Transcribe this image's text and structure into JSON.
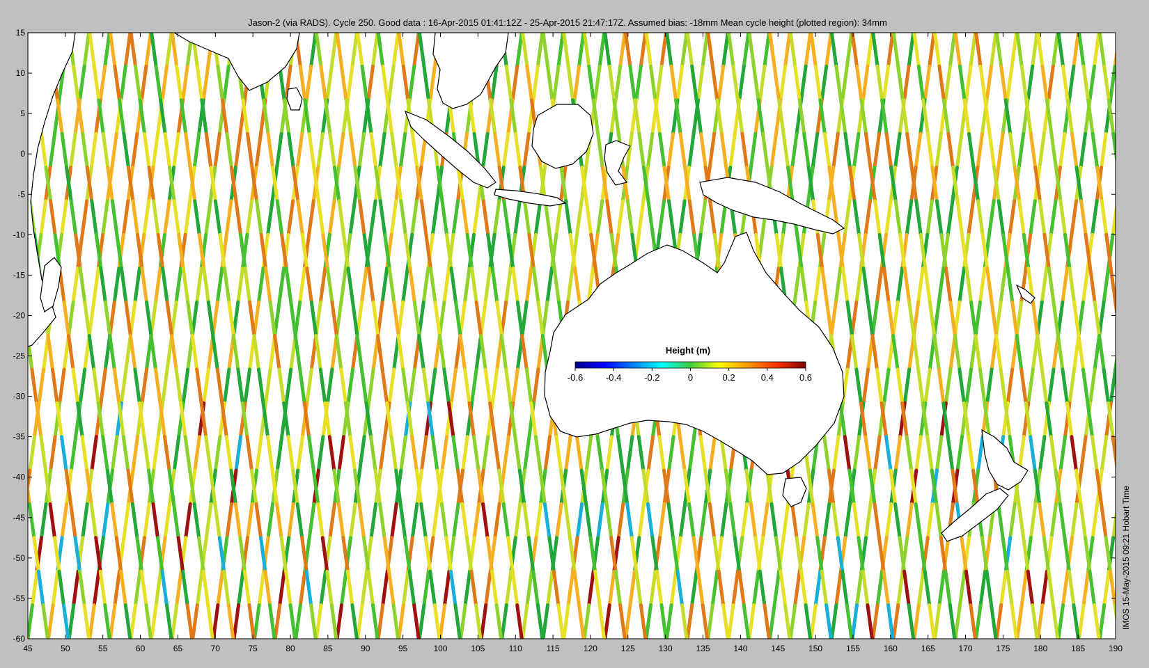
{
  "chart_data": {
    "type": "map",
    "title": "Jason-2 (via RADS). Cycle 250. Good data : 16-Apr-2015 01:41:12Z - 25-Apr-2015 21:47:17Z. Assumed bias: -18mm  Mean cycle height (plotted region): 34mm",
    "xlim": [
      45,
      190
    ],
    "ylim": [
      -60,
      15
    ],
    "x_ticks": [
      45,
      50,
      55,
      60,
      65,
      70,
      75,
      80,
      85,
      90,
      95,
      100,
      105,
      110,
      115,
      120,
      125,
      130,
      135,
      140,
      145,
      150,
      155,
      160,
      165,
      170,
      175,
      180,
      185,
      190
    ],
    "y_ticks": [
      15,
      10,
      5,
      0,
      -5,
      -10,
      -15,
      -20,
      -25,
      -30,
      -35,
      -40,
      -45,
      -50,
      -55,
      -60
    ],
    "colorbar": {
      "label": "Height (m)",
      "range": [
        -0.6,
        0.6
      ],
      "ticks": [
        "-0.6",
        "-0.4",
        "-0.2",
        "0",
        "0.2",
        "0.4",
        "0.6"
      ],
      "colormap": "jet"
    },
    "track_colors": [
      "#22a83a",
      "#44c030",
      "#8ed22c",
      "#c6dc2a",
      "#e8e026",
      "#f4b020",
      "#e07a18"
    ],
    "hot_spot_color": "#a01010",
    "cold_spot_color": "#18b0d8",
    "land_color": "#ffffff",
    "coast_color": "#000000",
    "footer": "IMOS 15-May-2015 09:21 Hobart Time"
  }
}
